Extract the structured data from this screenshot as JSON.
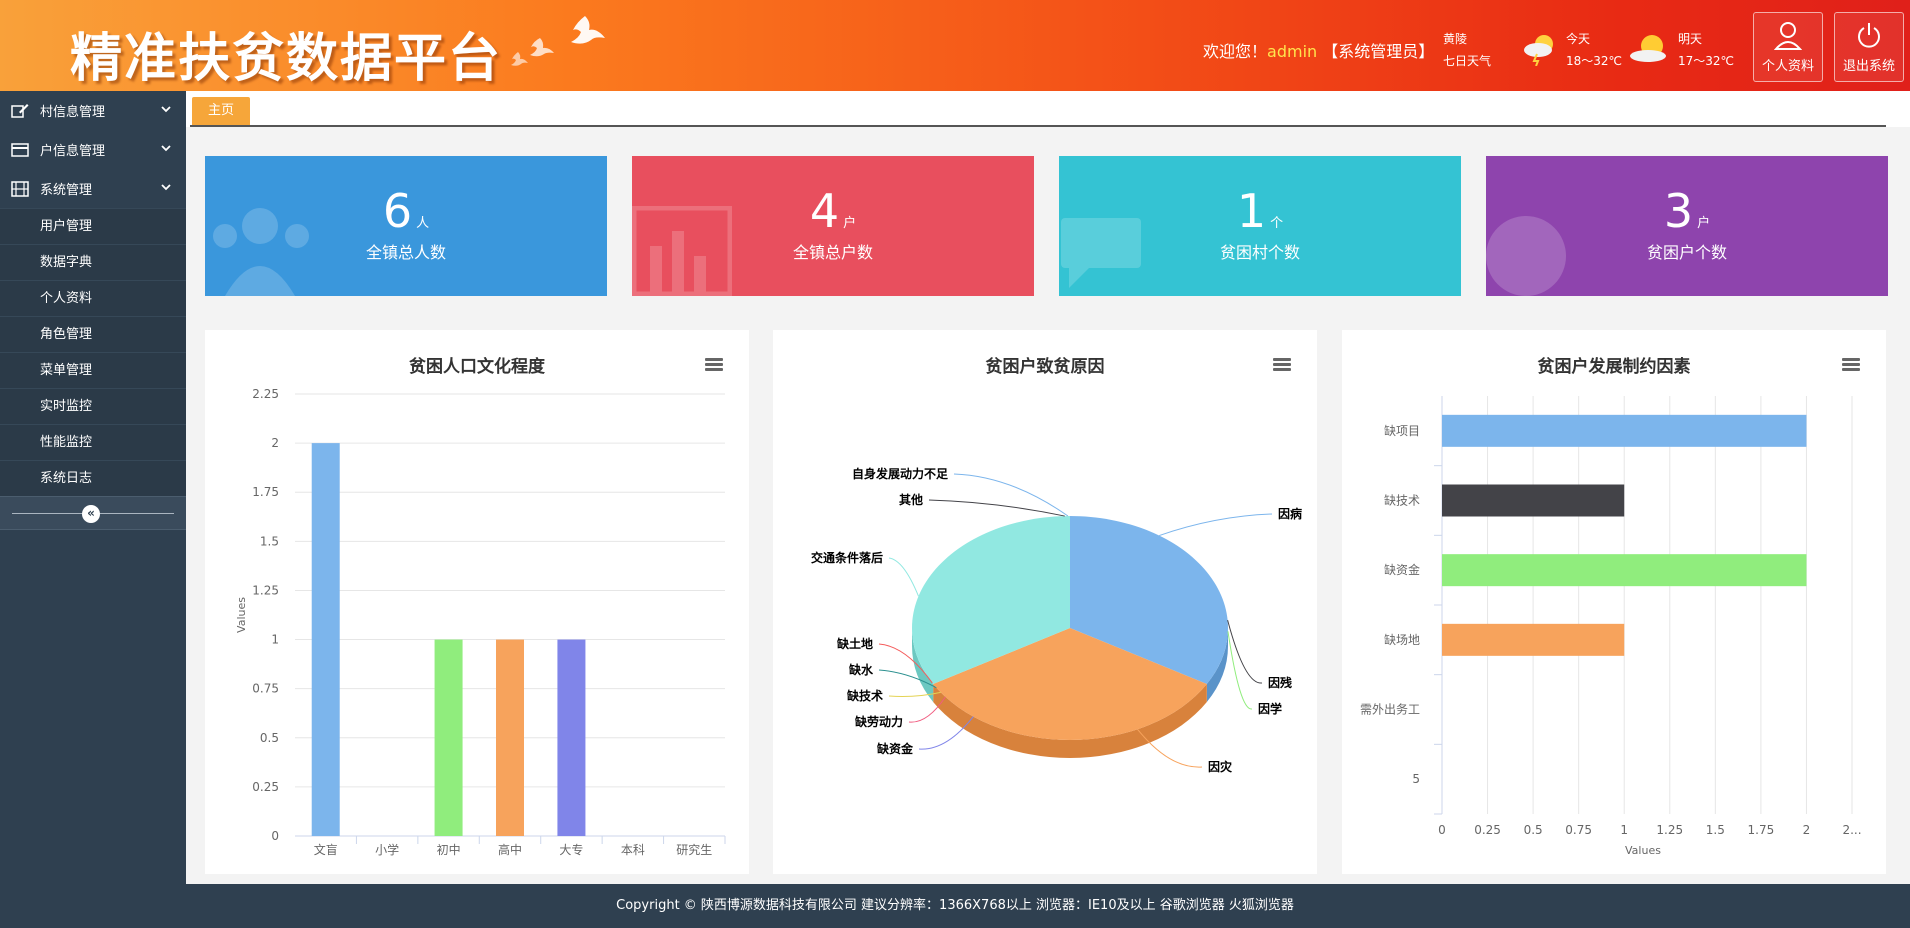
{
  "header": {
    "title": "精准扶贫数据平台",
    "welcome_prefix": "欢迎您！",
    "username": "admin",
    "role": "【系统管理员】",
    "weather": {
      "location": "黄陵",
      "forecast_link": "七日天气",
      "today_label": "今天",
      "today_temp": "18～32℃",
      "tomorrow_label": "明天",
      "tomorrow_temp": "17～32℃"
    },
    "profile_button": "个人资料",
    "logout_button": "退出系统"
  },
  "sidebar": {
    "groups": [
      {
        "label": "村信息管理",
        "icon": "edit-icon"
      },
      {
        "label": "户信息管理",
        "icon": "card-icon"
      },
      {
        "label": "系统管理",
        "icon": "film-icon"
      }
    ],
    "sub_items": [
      "用户管理",
      "数据字典",
      "个人资料",
      "角色管理",
      "菜单管理",
      "实时监控",
      "性能监控",
      "系统日志"
    ],
    "collapse_glyph": "«"
  },
  "tabs": {
    "home": "主页"
  },
  "stats": [
    {
      "value": "6",
      "unit": "人",
      "label": "全镇总人数",
      "color": "#3a97dc"
    },
    {
      "value": "4",
      "unit": "户",
      "label": "全镇总户数",
      "color": "#e84f5e"
    },
    {
      "value": "1",
      "unit": "个",
      "label": "贫困村个数",
      "color": "#34c3d3"
    },
    {
      "value": "3",
      "unit": "户",
      "label": "贫困户个数",
      "color": "#8e44ad"
    }
  ],
  "charts": {
    "education": {
      "title": "贫困人口文化程度"
    },
    "causes": {
      "title": "贫困户致贫原因"
    },
    "constraints": {
      "title": "贫困户发展制约因素"
    }
  },
  "chart_data": [
    {
      "type": "bar",
      "title": "贫困人口文化程度",
      "categories": [
        "文盲",
        "小学",
        "初中",
        "高中",
        "大专",
        "本科",
        "研究生"
      ],
      "values": [
        2,
        0,
        1,
        1,
        1,
        0,
        0
      ],
      "colors": [
        "#7cb5ec",
        "#434348",
        "#90ed7d",
        "#f7a35c",
        "#8085e9",
        "#f15c80",
        "#e4d354"
      ],
      "ylabel": "Values",
      "ylim": [
        0,
        2.25
      ],
      "yticks": [
        "0",
        "0.25",
        "0.5",
        "0.75",
        "1",
        "1.25",
        "1.5",
        "1.75",
        "2",
        "2.25"
      ],
      "grid": true
    },
    {
      "type": "pie",
      "title": "贫困户致贫原因",
      "labels": [
        "因病",
        "因残",
        "因学",
        "因灾",
        "缺资金",
        "缺劳动力",
        "缺技术",
        "缺水",
        "缺土地",
        "交通条件落后",
        "其他",
        "自身发展动力不足"
      ],
      "values": [
        1,
        0,
        0,
        1,
        0,
        0,
        0,
        0,
        0,
        1,
        0,
        0
      ],
      "colors": [
        "#7cb5ec",
        "#434348",
        "#90ed7d",
        "#f7a35c",
        "#8085e9",
        "#f15c80",
        "#e4d354",
        "#2b908f",
        "#f45b5b",
        "#91e8e1",
        "#434348",
        "#7cb5ec"
      ]
    },
    {
      "type": "bar",
      "orientation": "horizontal",
      "title": "贫困户发展制约因素",
      "categories": [
        "缺项目",
        "缺技术",
        "缺资金",
        "缺场地",
        "需外出务工",
        "5"
      ],
      "values": [
        2,
        1,
        2,
        1,
        0,
        0
      ],
      "colors": [
        "#7cb5ec",
        "#434348",
        "#90ed7d",
        "#f7a35c",
        "#8085e9",
        "#f15c80"
      ],
      "xlabel": "Values",
      "xlim": [
        0,
        2.25
      ],
      "xticks": [
        "0",
        "0.25",
        "0.5",
        "0.75",
        "1",
        "1.25",
        "1.5",
        "1.75",
        "2",
        "2..."
      ],
      "grid": true
    }
  ],
  "footer": "Copyright © 陕西博源数据科技有限公司  建议分辨率：1366X768以上  浏览器：IE10及以上  谷歌浏览器  火狐浏览器"
}
